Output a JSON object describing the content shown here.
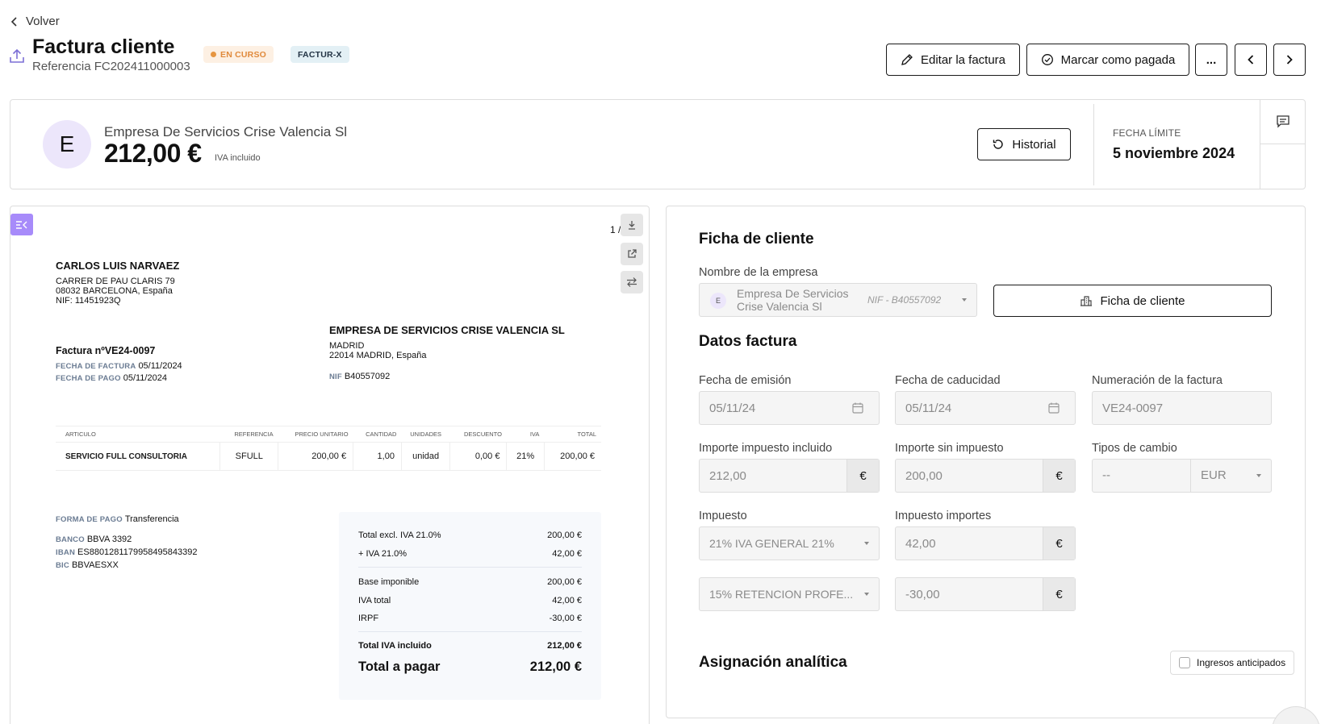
{
  "header": {
    "back_label": "Volver",
    "title": "Factura cliente",
    "reference": "Referencia FC202411000003",
    "status_badge": "EN CURSO",
    "format_badge": "FACTUR-X",
    "edit_label": "Editar la factura",
    "paid_label": "Marcar como pagada",
    "more_label": "..."
  },
  "summary": {
    "avatar_letter": "E",
    "company": "Empresa De Servicios Crise Valencia Sl",
    "amount": "212,00 €",
    "tax_note": "IVA incluido",
    "history_label": "Historial",
    "due_label": "FECHA LÍMITE",
    "due_value": "5 noviembre 2024"
  },
  "preview": {
    "page_indicator": "1 /",
    "seller": {
      "name": "CARLOS LUIS NARVAEZ",
      "address1": "CARRER DE PAU CLARIS 79",
      "address2": "08032 BARCELONA, España",
      "nif": "NIF: 11451923Q"
    },
    "buyer": {
      "name": "EMPRESA DE SERVICIOS CRISE VALENCIA SL",
      "address1": "MADRID",
      "address2": "22014 MADRID, España",
      "nif_label": "NIF",
      "nif": "B40557092"
    },
    "invoice": {
      "number": "Factura nºVE24-0097",
      "date_label": "FECHA DE FACTURA",
      "date": "05/11/2024",
      "pay_date_label": "FECHA DE PAGO",
      "pay_date": "05/11/2024"
    },
    "table": {
      "headers": [
        "ARTICULO",
        "REFERENCIA",
        "PRECIO UNITARIO",
        "CANTIDAD",
        "UNIDADES",
        "DESCUENTO",
        "IVA",
        "TOTAL"
      ],
      "row": [
        "SERVICIO FULL CONSULTORIA",
        "SFULL",
        "200,00 €",
        "1,00",
        "unidad",
        "0,00 €",
        "21%",
        "200,00 €"
      ]
    },
    "payment": {
      "method_label": "FORMA DE PAGO",
      "method": "Transferencia",
      "bank_label": "BANCO",
      "bank": "BBVA 3392",
      "iban_label": "IBAN",
      "iban": "ES8801281179958495843392",
      "bic_label": "BIC",
      "bic": "BBVAESXX"
    },
    "totals": {
      "excl_label": "Total excl. IVA 21.0%",
      "excl": "200,00 €",
      "iva_label": "+ IVA 21.0%",
      "iva": "42,00 €",
      "base_label": "Base imponible",
      "base": "200,00 €",
      "iva_total_label": "IVA total",
      "iva_total": "42,00 €",
      "irpf_label": "IRPF",
      "irpf": "-30,00 €",
      "incl_label": "Total IVA incluido",
      "incl": "212,00 €",
      "pay_label": "Total a pagar",
      "pay": "212,00 €"
    }
  },
  "form": {
    "client_section": "Ficha de cliente",
    "company_label": "Nombre de la empresa",
    "company_avatar": "E",
    "company_value": "Empresa De Servicios Crise Valencia Sl",
    "company_nif": "NIF - B40557092",
    "client_button": "Ficha de cliente",
    "invoice_section": "Datos factura",
    "issue_label": "Fecha de emisión",
    "issue_value": "05/11/24",
    "expiry_label": "Fecha de caducidad",
    "expiry_value": "05/11/24",
    "number_label": "Numeración de la factura",
    "number_value": "VE24-0097",
    "incl_label": "Importe impuesto incluido",
    "incl_value": "212,00",
    "excl_label": "Importe sin impuesto",
    "excl_value": "200,00",
    "fx_label": "Tipos de cambio",
    "fx_value": "--",
    "currency_value": "EUR",
    "currency_symbol": "€",
    "tax_label": "Impuesto",
    "tax_value": "21% IVA GENERAL 21%",
    "tax_amount_label": "Impuesto importes",
    "tax_amount_value": "42,00",
    "tax2_value": "15% RETENCION PROFE...",
    "tax2_amount_value": "-30,00",
    "analytic_section": "Asignación analítica",
    "advance_label": "Ingresos anticipados"
  }
}
